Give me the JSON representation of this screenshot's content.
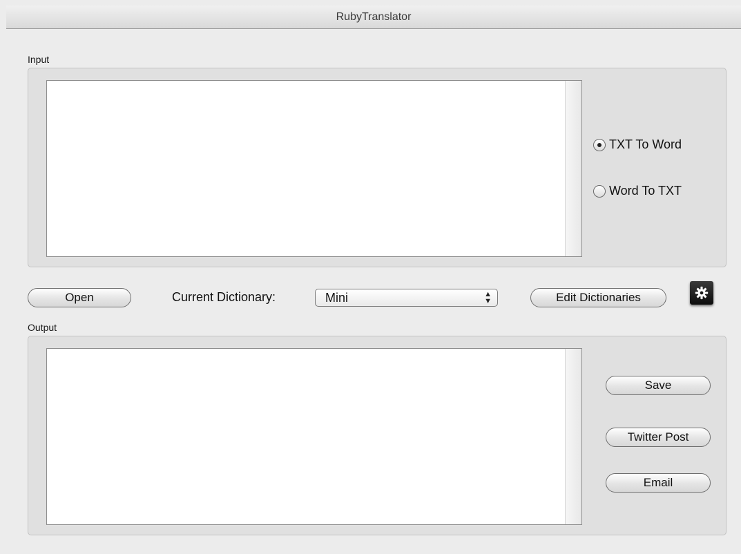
{
  "window": {
    "title": "RubyTranslator"
  },
  "input_group": {
    "label": "Input",
    "text": ""
  },
  "mode_options": [
    {
      "label": "TXT To Word",
      "selected": true
    },
    {
      "label": "Word To TXT",
      "selected": false
    }
  ],
  "toolbar": {
    "open_label": "Open",
    "dictionary_label": "Current Dictionary:",
    "dictionary_value": "Mini",
    "edit_dictionaries_label": "Edit Dictionaries",
    "settings_icon": "gear-icon"
  },
  "output_group": {
    "label": "Output",
    "text": ""
  },
  "output_actions": {
    "save_label": "Save",
    "twitter_label": "Twitter Post",
    "email_label": "Email"
  }
}
